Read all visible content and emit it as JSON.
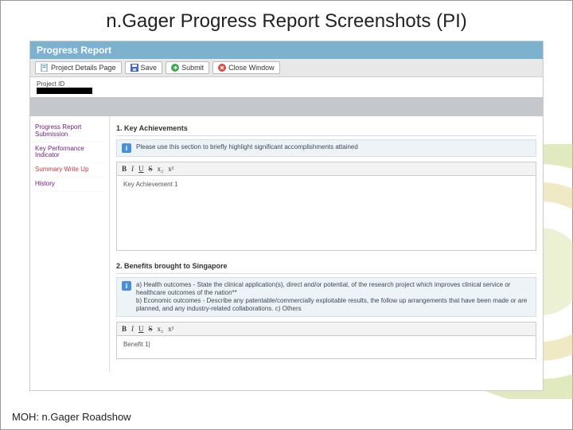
{
  "slide": {
    "title": "n.Gager Progress Report Screenshots (PI)",
    "footer": "MOH: n.Gager Roadshow"
  },
  "app": {
    "header": "Progress Report",
    "projectIdLabel": "Project ID"
  },
  "toolbar": {
    "project_details": "Project Details Page",
    "save": "Save",
    "submit": "Submit",
    "close": "Close Window"
  },
  "sidebar": {
    "items": [
      {
        "label": "Progress Report Submission"
      },
      {
        "label": "Key Performance Indicator"
      },
      {
        "label": "Summary Write Up"
      },
      {
        "label": "History"
      }
    ]
  },
  "sections": {
    "s1": {
      "title": "1. Key Achievements",
      "hint": "Please use this section to briefly highlight significant accomplishments attained",
      "placeholder": "Key Achievement 1"
    },
    "s2": {
      "title": "2. Benefits brought to Singapore",
      "hint": "a) Health outcomes - State the clinical application(s), direct and/or potential, of the research project which improves clinical service or healthcare outcomes of the nation**\nb) Economic outcomes - Describe any patentable/commercially exploitable results, the follow up arrangements that have been made or are planned, and any industry-related collaborations. c) Others",
      "placeholder": "Benefit 1|"
    }
  },
  "editor": {
    "bold": "B",
    "italic": "I",
    "underline": "U",
    "strike": "S",
    "sub": "x₂",
    "sup": "x²"
  }
}
